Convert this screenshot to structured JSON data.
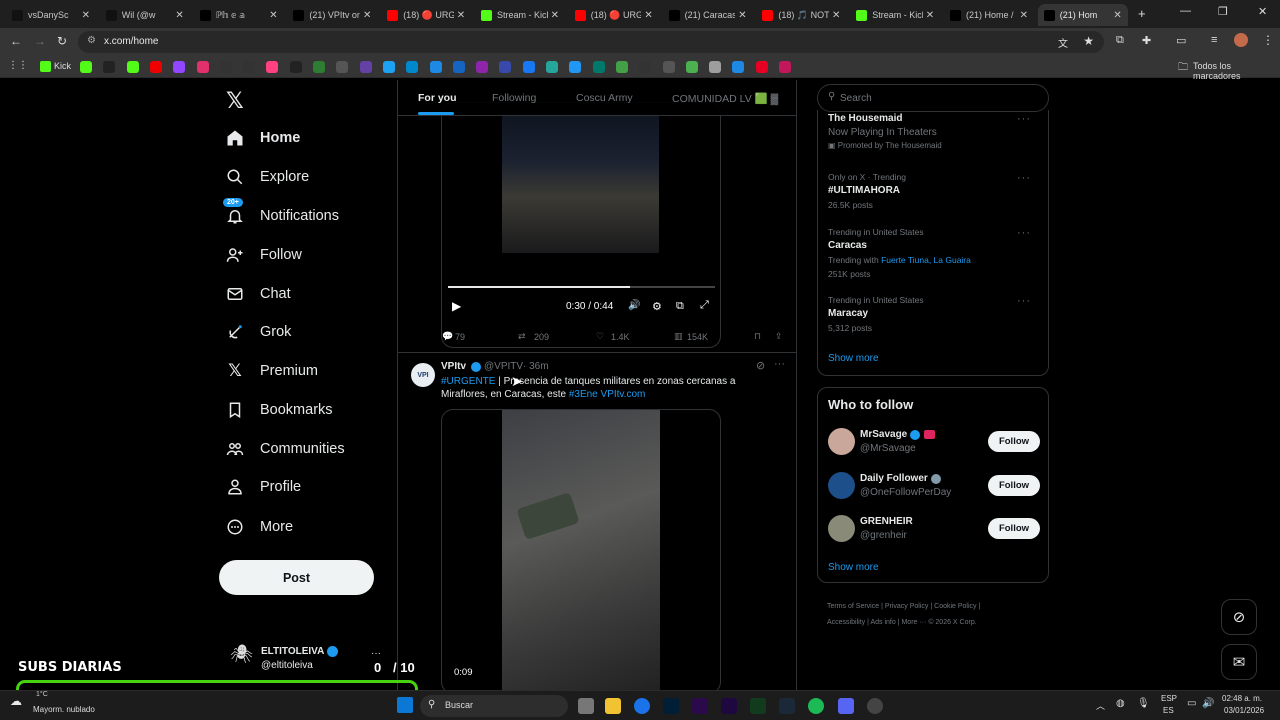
{
  "browser": {
    "tabs": [
      {
        "title": "vsDanySc",
        "fav": "tiktok",
        "color": "#111"
      },
      {
        "title": "Wil (@w",
        "fav": "tiktok",
        "color": "#111"
      },
      {
        "title": "ℙ𝕙 𝕖 𝕒",
        "fav": "x",
        "color": "#000"
      },
      {
        "title": "(21) VPItv on",
        "fav": "x",
        "color": "#000"
      },
      {
        "title": "(18) 🔴 URG",
        "fav": "youtube",
        "color": "#f00"
      },
      {
        "title": "Stream - Kick",
        "fav": "kick",
        "color": "#53fc18"
      },
      {
        "title": "(18) 🔴 URG",
        "fav": "youtube",
        "color": "#f00"
      },
      {
        "title": "(21) Caracas",
        "fav": "x",
        "color": "#000"
      },
      {
        "title": "(18) 🎵 NOT",
        "fav": "youtube",
        "color": "#f00"
      },
      {
        "title": "Stream - Kick",
        "fav": "kick",
        "color": "#53fc18"
      },
      {
        "title": "(21) Home /",
        "fav": "x",
        "color": "#000"
      },
      {
        "title": "(21) Hom",
        "fav": "x",
        "color": "#000"
      }
    ],
    "url": "x.com/home",
    "all_bookmarks": "Todos los marcadores",
    "bookmark_kick": "Kick"
  },
  "nav": {
    "home": "Home",
    "explore": "Explore",
    "notifications": "Notifications",
    "notif_badge": "20+",
    "follow": "Follow",
    "chat": "Chat",
    "grok": "Grok",
    "premium": "Premium",
    "bookmarks": "Bookmarks",
    "communities": "Communities",
    "profile": "Profile",
    "more": "More",
    "post": "Post",
    "account_name": "ELTITOLEIVA",
    "account_handle": "@eltitoleiva"
  },
  "feed": {
    "tabs": [
      "For you",
      "Following",
      "Coscu Army",
      "COMUNIDAD LV 🟩 ▓"
    ],
    "video1": {
      "time": "0:30 / 0:44",
      "progress": 0.68
    },
    "stats1": {
      "replies": "79",
      "reposts": "209",
      "likes": "1.4K",
      "views": "154K"
    },
    "tweet2": {
      "name": "VPItv",
      "handle": "@VPITV",
      "time": "· 36m",
      "hashtag": "#URGENTE",
      "text": " | Presencia de tanques militares en zonas cercanas a Miraflores, en Caracas, este ",
      "tag2": "#3Ene",
      "link": "VPItv.com",
      "video_time": "0:09"
    }
  },
  "sidebar": {
    "search_placeholder": "Search",
    "trends": [
      {
        "context": "",
        "title": "The Housemaid",
        "sub": "Now Playing In Theaters",
        "meta": "Promoted by The Housemaid"
      },
      {
        "context": "Only on X · Trending",
        "title": "#ULTIMAHORA",
        "sub": "",
        "meta": "26.5K posts"
      },
      {
        "context": "Trending in United States",
        "title": "Caracas",
        "sub": "Trending with",
        "links": "Fuerte Tiuna, La Guaira",
        "meta": "251K posts"
      },
      {
        "context": "Trending in United States",
        "title": "Maracay",
        "sub": "",
        "meta": "5,312 posts"
      }
    ],
    "show_more": "Show more",
    "who_to_follow": "Who to follow",
    "suggestions": [
      {
        "name": "MrSavage",
        "handle": "@MrSavage",
        "btn": "Follow"
      },
      {
        "name": "Daily Follower",
        "handle": "@OneFollowPerDay",
        "btn": "Follow"
      },
      {
        "name": "GRENHEIR",
        "handle": "@grenheir",
        "btn": "Follow"
      }
    ],
    "show_more2": "Show more",
    "footer1": [
      "Terms of Service",
      "Privacy Policy",
      "Cookie Policy"
    ],
    "footer2": [
      "Accessibility",
      "Ads info",
      "More ···",
      "© 2026 X Corp."
    ]
  },
  "overlay": {
    "title": "SUBS DIARIAS",
    "count": "0",
    "goal": "/ 10",
    "progress": 0.0
  },
  "taskbar": {
    "weather_temp": "1°C",
    "weather": "Mayorm. nublado",
    "search": "Buscar",
    "lang1": "ESP",
    "lang2": "ES",
    "time": "02:48 a. m.",
    "date": "03/01/2026"
  }
}
